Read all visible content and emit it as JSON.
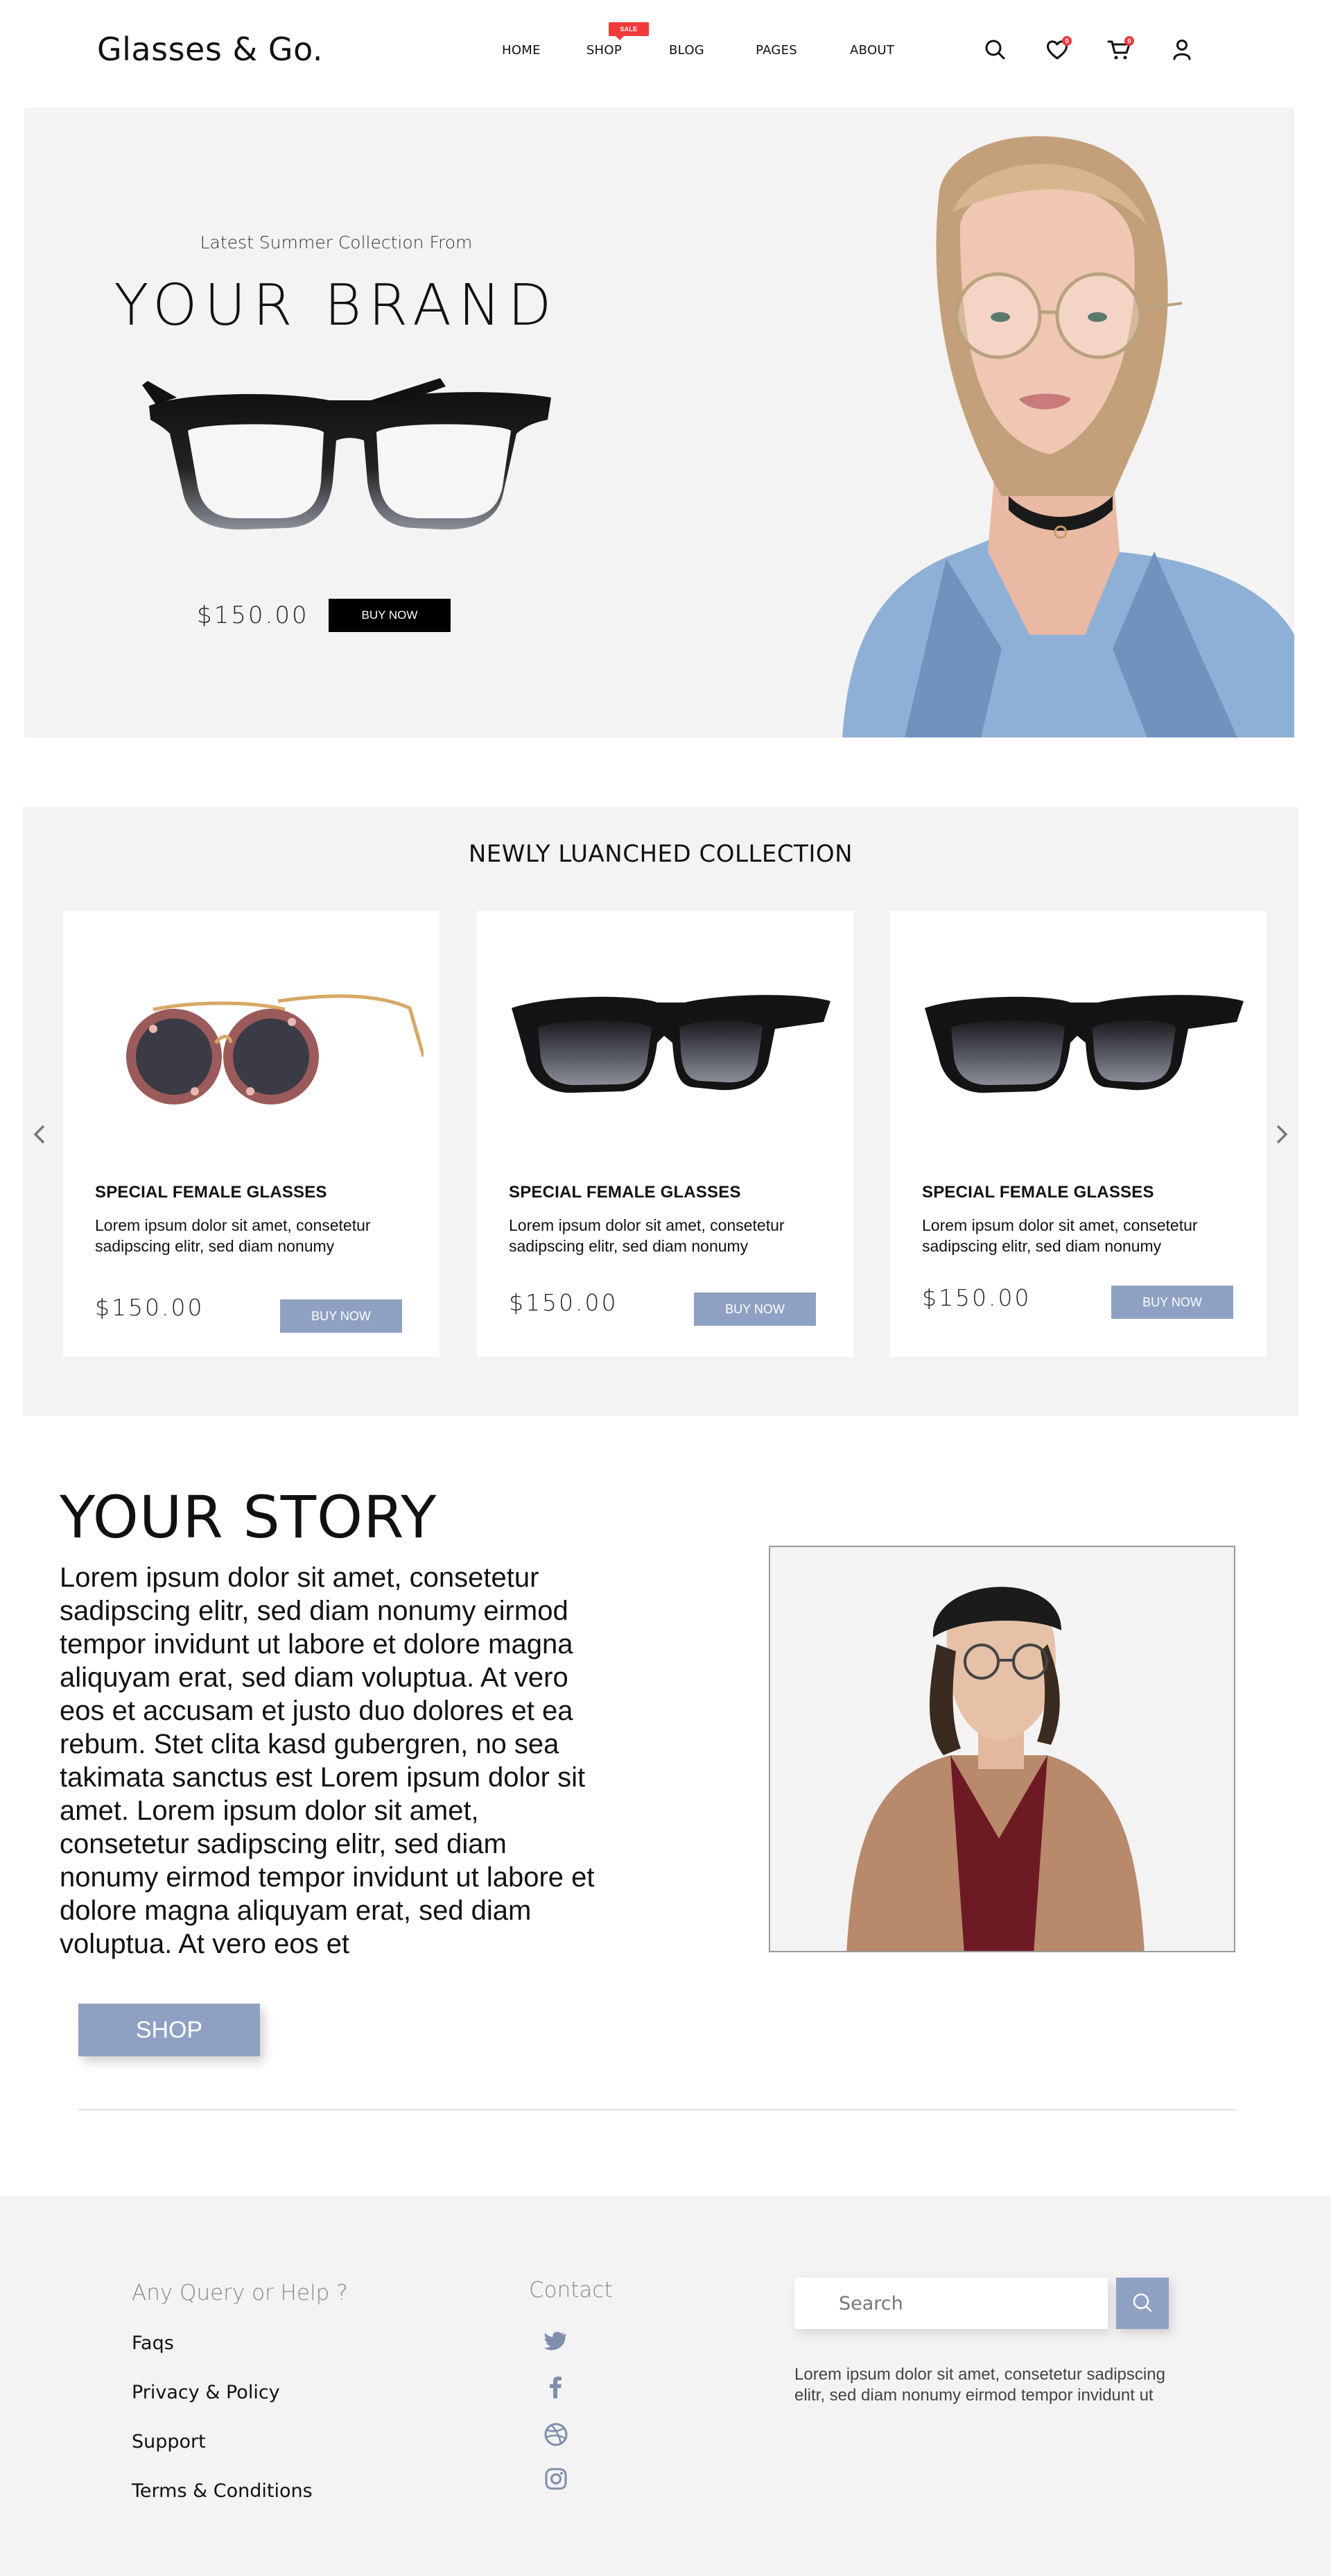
{
  "header": {
    "logo": "Glasses & Go.",
    "nav": [
      "HOME",
      "SHOP",
      "BLOG",
      "PAGES",
      "ABOUT"
    ],
    "sale_tag": "SALE",
    "icons": [
      "search-icon",
      "heart-icon",
      "cart-icon",
      "user-icon"
    ],
    "wishlist_count": "0",
    "cart_count": "0"
  },
  "hero": {
    "subtitle": "Latest Summer Collection From",
    "title": "YOUR BRAND",
    "price": "$150.00",
    "buy_label": "BUY NOW"
  },
  "collection": {
    "title": "NEWLY LUANCHED COLLECTION",
    "products": [
      {
        "name": "SPECIAL FEMALE GLASSES",
        "desc": "Lorem ipsum dolor sit amet, consetetur sadipscing elitr, sed diam nonumy",
        "price": "$150.00",
        "buy_label": "BUY NOW"
      },
      {
        "name": "SPECIAL FEMALE GLASSES",
        "desc": "Lorem ipsum dolor sit amet, consetetur sadipscing elitr, sed diam nonumy",
        "price": "$150.00",
        "buy_label": "BUY NOW"
      },
      {
        "name": "SPECIAL FEMALE GLASSES",
        "desc": "Lorem ipsum dolor sit amet, consetetur sadipscing elitr, sed diam nonumy",
        "price": "$150.00",
        "buy_label": "BUY NOW"
      }
    ]
  },
  "story": {
    "title": "YOUR STORY",
    "text": "Lorem ipsum dolor sit amet, consetetur sadipscing elitr, sed diam nonumy eirmod tempor invidunt ut labore et dolore magna aliquyam erat, sed diam voluptua. At vero eos et accusam et justo duo dolores et ea rebum. Stet clita kasd gubergren, no sea takimata sanctus est Lorem ipsum dolor sit amet. Lorem ipsum dolor sit amet, consetetur sadipscing elitr, sed diam nonumy eirmod tempor invidunt ut labore et dolore magna aliquyam erat, sed diam voluptua. At vero eos et",
    "shop_label": "SHOP"
  },
  "footer": {
    "help_title": "Any Query or Help ?",
    "links": [
      "Faqs",
      "Privacy & Policy",
      "Support",
      "Terms & Conditions"
    ],
    "contact_title": "Contact",
    "social": [
      "twitter-icon",
      "facebook-icon",
      "dribbble-icon",
      "instagram-icon"
    ],
    "search_placeholder": "Search",
    "note": "Lorem ipsum dolor sit amet, consetetur sadipscing elitr, sed diam nonumy eirmod tempor invidunt ut"
  },
  "colors": {
    "accent": "#8fa1c3",
    "badge": "#ef3b3b",
    "panel": "#f3f3f3",
    "hero_button": "#000000"
  }
}
